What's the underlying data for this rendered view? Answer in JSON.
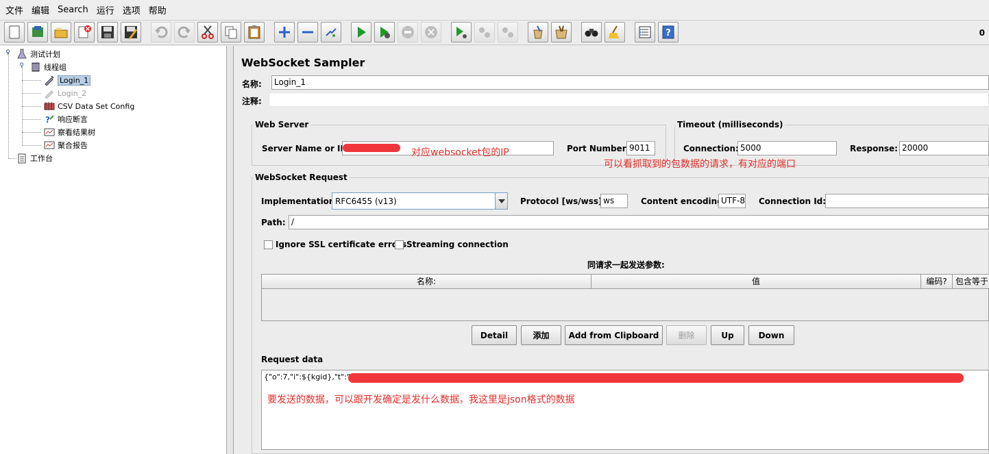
{
  "menubar": {
    "items": [
      "文件",
      "编辑",
      "Search",
      "运行",
      "选项",
      "帮助"
    ]
  },
  "toolbar": {
    "buttons": [
      {
        "icon": "new-icon"
      },
      {
        "icon": "templates-icon"
      },
      {
        "icon": "open-icon"
      },
      {
        "icon": "close-icon"
      },
      {
        "icon": "save-icon"
      },
      {
        "icon": "save-as-icon"
      },
      {
        "icon": "undo-icon",
        "disabled": true
      },
      {
        "icon": "redo-icon",
        "disabled": true
      },
      {
        "icon": "cut-icon"
      },
      {
        "icon": "copy-icon"
      },
      {
        "icon": "paste-icon"
      },
      {
        "icon": "expand-icon"
      },
      {
        "icon": "collapse-icon"
      },
      {
        "icon": "toggle-icon"
      },
      {
        "icon": "start-icon"
      },
      {
        "icon": "start-no-pauses-icon"
      },
      {
        "icon": "stop-icon",
        "disabled": true
      },
      {
        "icon": "shutdown-icon",
        "disabled": true
      },
      {
        "icon": "remote-start-icon"
      },
      {
        "icon": "remote-stop-icon",
        "disabled": true
      },
      {
        "icon": "remote-shutdown-icon",
        "disabled": true
      },
      {
        "icon": "clear-icon"
      },
      {
        "icon": "clear-all-icon"
      },
      {
        "icon": "search-icon"
      },
      {
        "icon": "reset-search-icon"
      },
      {
        "icon": "function-helper-icon"
      },
      {
        "icon": "help-icon"
      }
    ],
    "counter": "0"
  },
  "tree": {
    "test_plan": "测试计划",
    "thread_group": "线程组",
    "login_1": "Login_1",
    "login_2": "Login_2",
    "csv": "CSV Data Set Config",
    "assertion": "响应断言",
    "results_tree": "察看结果树",
    "aggregate": "聚合报告",
    "workbench": "工作台"
  },
  "sampler": {
    "title": "WebSocket Sampler",
    "name_label": "名称:",
    "name_value": "Login_1",
    "comment_label": "注释:",
    "comment_value": "",
    "web_server": {
      "legend": "Web Server",
      "server_label": "Server Name or IP:",
      "server_value": "",
      "port_label": "Port Number:",
      "port_value": "9011"
    },
    "timeout": {
      "legend": "Timeout (milliseconds)",
      "connection_label": "Connection:",
      "connection_value": "5000",
      "response_label": "Response:",
      "response_value": "20000"
    },
    "request": {
      "legend": "WebSocket Request",
      "impl_label": "Implementation:",
      "impl_value": "RFC6455 (v13)",
      "protocol_label": "Protocol [ws/wss]:",
      "protocol_value": "ws",
      "encoding_label": "Content encoding:",
      "encoding_value": "UTF-8",
      "connid_label": "Connection Id:",
      "connid_value": "",
      "path_label": "Path:",
      "path_value": "/",
      "ignore_ssl": "Ignore SSL certificate errors",
      "streaming": "Streaming connection"
    },
    "params": {
      "caption": "同请求一起发送参数:",
      "columns": [
        "名称:",
        "值",
        "编码?",
        "包含等于?"
      ]
    },
    "buttons": {
      "detail": "Detail",
      "add": "添加",
      "add_clipboard": "Add from Clipboard",
      "delete": "删除",
      "up": "Up",
      "down": "Down"
    },
    "request_data_label": "Request data",
    "request_data_value": "{\"o\":7,\"i\":${kgid},\"t\":\"\",\"s\":"
  },
  "annotations": {
    "ip_note": "对应websocket包的IP",
    "port_note": "可以看抓取到的包数据的请求，有对应的端口",
    "data_note": "要发送的数据，可以跟开发确定是发什么数据，我这里是json格式的数据"
  },
  "colors": {
    "annotation": "#e0302b",
    "selection": "#b8cfe5"
  }
}
